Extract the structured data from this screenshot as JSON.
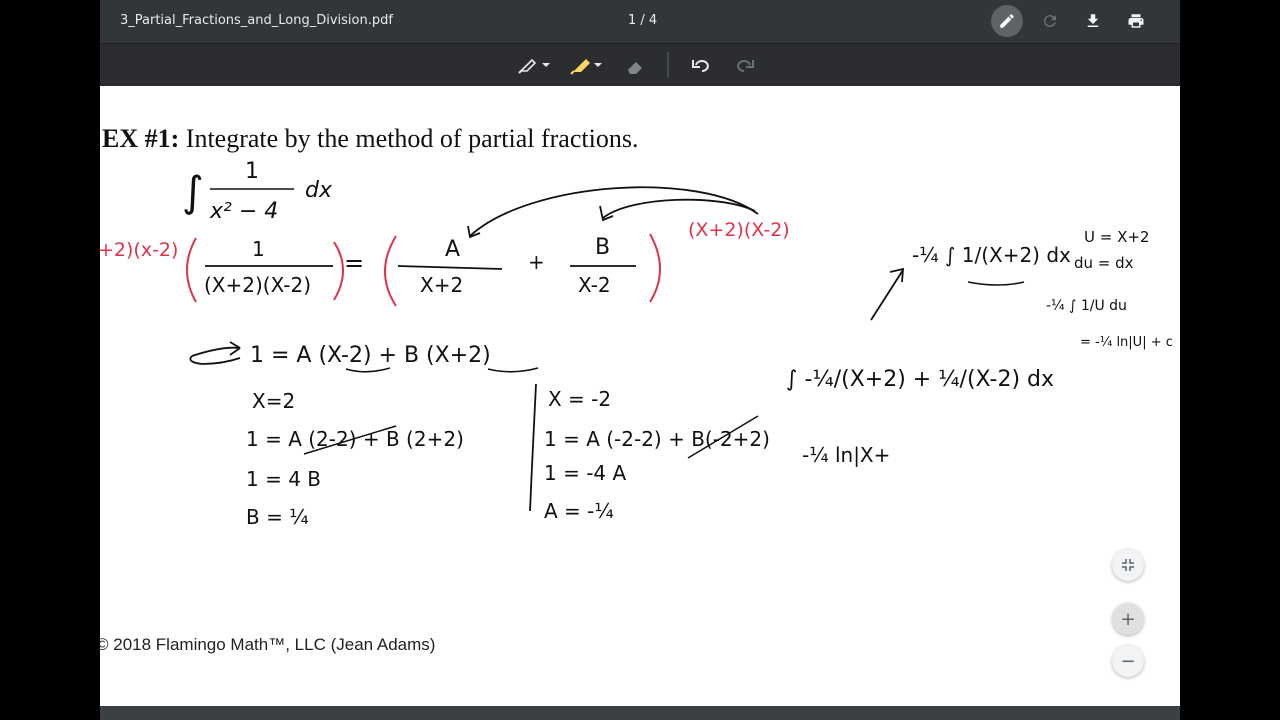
{
  "viewer": {
    "filename": "3_Partial_Fractions_and_Long_Division.pdf",
    "page_indicator": "1 / 4"
  },
  "toolbar": {
    "icons": [
      "pen-icon",
      "rotate-icon",
      "download-icon",
      "print-icon"
    ],
    "annotation_tools": [
      "pen-tool-icon",
      "highlighter-icon",
      "eraser-icon",
      "undo-icon",
      "redo-icon"
    ]
  },
  "doc": {
    "heading_label": "EX #1:",
    "heading_text": " Integrate by the method of partial fractions.",
    "integral_numerator": "1",
    "integral_denominator": "x² − 4",
    "integral_dx": "dx",
    "copyright": "© 2018 Flamingo Math™, LLC (Jean Adams)"
  },
  "handwriting": {
    "red_factor_left": "+2)(x-2)",
    "red_factor_right": "(X+2)(X-2)",
    "frac_lhs_num": "1",
    "frac_lhs_den": "(X+2)(X-2)",
    "equals": "=",
    "frac_a_num": "A",
    "frac_a_den": "X+2",
    "plus": "+",
    "frac_b_num": "B",
    "frac_b_den": "X-2",
    "eq_main": "1  = A (X-2) + B (X+2)",
    "left_case_x": "X=2",
    "left_case_l1": "1  =  A (2-2) + B (2+2)",
    "left_case_l2": "1  = 4 B",
    "left_case_l3": "B = ¼",
    "right_case_x": "X = -2",
    "right_case_l1": "1 = A (-2-2) + B(-2+2)",
    "right_case_l2": "1 = -4 A",
    "right_case_l3": "A = -¼",
    "rhs_integral": "∫  -¼/(X+2)  +  ¼/(X-2)  dx",
    "rhs_top": "-¼ ∫ 1/(X+2) dx",
    "sub_u": "U = X+2",
    "sub_du": "du = dx",
    "sub_int": "-¼ ∫ 1/U du",
    "sub_result": "= -¼ ln|U| + c",
    "partial_answer": "-¼ ln|X+"
  },
  "zoom": {
    "fit": "fit-icon",
    "plus": "+",
    "minus": "−"
  },
  "colors": {
    "ink": "#111111",
    "red_ink": "#e0334a",
    "toolbar": "#323639"
  }
}
